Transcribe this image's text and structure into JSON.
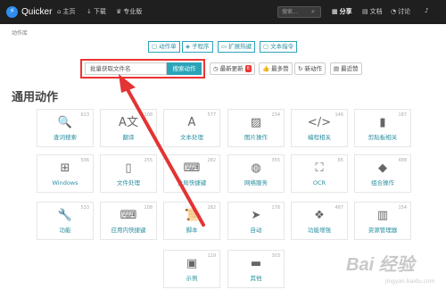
{
  "navbar": {
    "brand": "Quicker",
    "links": [
      {
        "icon": "home-icon",
        "glyph": "⌂",
        "label": "主页"
      },
      {
        "icon": "download-icon",
        "glyph": "↓",
        "label": "下载"
      },
      {
        "icon": "pro-icon",
        "glyph": "♛",
        "label": "专业版"
      }
    ],
    "search_placeholder": "搜索...",
    "right": [
      {
        "icon": "share-icon",
        "glyph": "▦",
        "label": "分享"
      },
      {
        "icon": "docs-icon",
        "glyph": "▤",
        "label": "文档"
      },
      {
        "icon": "discuss-icon",
        "glyph": "◔",
        "label": "讨论"
      },
      {
        "icon": "bell-icon",
        "glyph": "♪",
        "label": ""
      }
    ]
  },
  "breadcrumb": "动作库",
  "top_tabs": [
    {
      "icon": "action-list-icon",
      "glyph": "▢",
      "label": "动作单"
    },
    {
      "icon": "subprogram-icon",
      "glyph": "◈",
      "label": "子程序"
    },
    {
      "icon": "keyboard-icon",
      "glyph": "▭",
      "label": "扩展热键"
    },
    {
      "icon": "text-cmd-icon",
      "glyph": "▢",
      "label": "文本指令"
    }
  ],
  "search": {
    "value": "批量获取文件名",
    "button": "搜索动作"
  },
  "filters": [
    {
      "icon": "clock-icon",
      "glyph": "◷",
      "label": "最新更新",
      "badge": "6"
    },
    {
      "icon": "thumbs-up-icon",
      "glyph": "👍",
      "label": "最多赞"
    },
    {
      "icon": "refresh-icon",
      "glyph": "↻",
      "label": "新动作"
    },
    {
      "icon": "recent-icon",
      "glyph": "▤",
      "label": "最近赞"
    }
  ],
  "section_title": "通用动作",
  "categories": [
    {
      "icon": "search-icon",
      "glyph": "🔍",
      "label": "查词搜索",
      "count": "613"
    },
    {
      "icon": "translate-icon",
      "glyph": "A文",
      "label": "翻译",
      "count": "108"
    },
    {
      "icon": "text-icon",
      "glyph": "A",
      "label": "文本处理",
      "count": "577"
    },
    {
      "icon": "image-icon",
      "glyph": "▨",
      "label": "图片操作",
      "count": "234"
    },
    {
      "icon": "code-icon",
      "glyph": "</>",
      "label": "编程相关",
      "count": "146"
    },
    {
      "icon": "clipboard-icon",
      "glyph": "▮",
      "label": "剪贴板相关",
      "count": "187"
    },
    {
      "icon": "windows-icon",
      "glyph": "⊞",
      "label": "Windows",
      "count": "506"
    },
    {
      "icon": "file-icon",
      "glyph": "▯",
      "label": "文件处理",
      "count": "255"
    },
    {
      "icon": "keyboard-icon",
      "glyph": "⌨",
      "label": "全局快捷键",
      "count": "282"
    },
    {
      "icon": "globe-icon",
      "glyph": "◍",
      "label": "网络服务",
      "count": "355"
    },
    {
      "icon": "ocr-icon",
      "glyph": "⛶",
      "label": "OCR",
      "count": "65"
    },
    {
      "icon": "combo-icon",
      "glyph": "◆",
      "label": "组合操作",
      "count": "488"
    },
    {
      "icon": "wrench-icon",
      "glyph": "🔧",
      "label": "功能",
      "count": "533"
    },
    {
      "icon": "app-keyboard-icon",
      "glyph": "⌨",
      "label": "应用内快捷键",
      "count": "108"
    },
    {
      "icon": "script-icon",
      "glyph": "📜",
      "label": "脚本",
      "count": "282"
    },
    {
      "icon": "send-icon",
      "glyph": "➤",
      "label": "自动",
      "count": "178"
    },
    {
      "icon": "cubes-icon",
      "glyph": "❖",
      "label": "功能增强",
      "count": "487"
    },
    {
      "icon": "resource-manager-icon",
      "glyph": "▥",
      "label": "资源管理器",
      "count": "154"
    },
    {
      "icon": "presentation-icon",
      "glyph": "▣",
      "label": "示例",
      "count": "119"
    },
    {
      "icon": "folder-icon",
      "glyph": "▬",
      "label": "其他",
      "count": "303"
    }
  ],
  "watermark": "Bai 经验",
  "watermark_sub": "jingyan.baidu.com",
  "colors": {
    "accent": "#2ba3b8",
    "highlight": "#e33333",
    "navbar": "#1f1f1f"
  }
}
